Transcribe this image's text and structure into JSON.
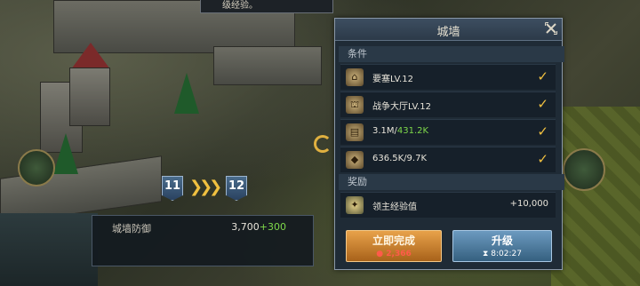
{
  "top_notice": "级经验。",
  "upgrade_indicator": {
    "from_level": "11",
    "to_level": "12"
  },
  "wall_defense": {
    "label": "城墙防御",
    "value": "3,700",
    "bonus": "+300"
  },
  "panel": {
    "title": "城墙",
    "conditions_label": "条件",
    "requirements": [
      {
        "icon": "fortress-icon",
        "text": "要塞LV.12",
        "met": true
      },
      {
        "icon": "war-hall-icon",
        "text": "战争大厅LV.12",
        "met": true
      },
      {
        "icon": "wood-resource-icon",
        "have": "3.1M",
        "need": "431.2K",
        "met": true
      },
      {
        "icon": "ore-resource-icon",
        "text": "636.5K/9.7K",
        "met": true
      }
    ],
    "rewards_label": "奖励",
    "reward": {
      "icon": "lord-xp-icon",
      "label": "领主经验值",
      "amount": "+10,000"
    },
    "finish_button": {
      "label": "立即完成",
      "cost": "2,366"
    },
    "upgrade_button": {
      "label": "升级",
      "time": "8:02:27"
    }
  },
  "colors": {
    "gold_accent": "#f0c040",
    "ok_green": "#7ed84a",
    "cost_red": "#ff5a4a"
  }
}
